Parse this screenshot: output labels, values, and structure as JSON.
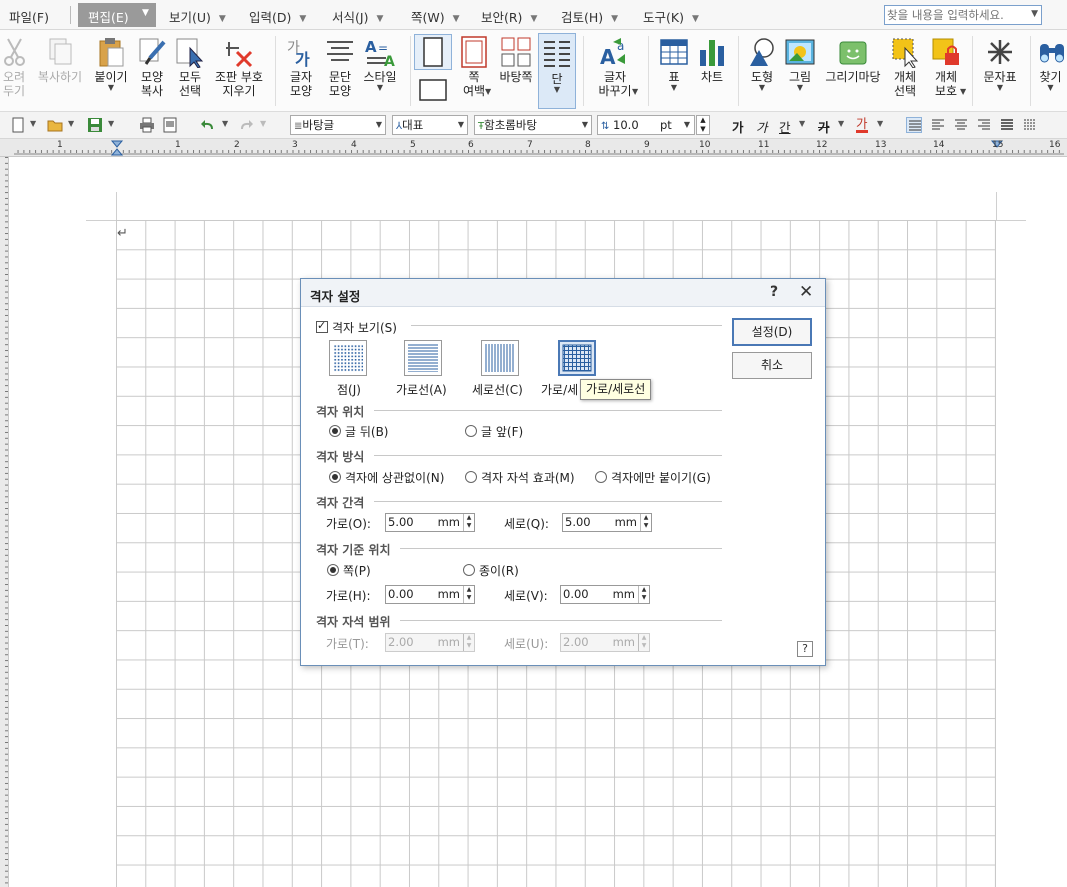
{
  "menubar": {
    "items": [
      {
        "label": "파일(F)"
      },
      {
        "label": "편집(E)"
      },
      {
        "label": "보기(U)"
      },
      {
        "label": "입력(D)"
      },
      {
        "label": "서식(J)"
      },
      {
        "label": "쪽(W)"
      },
      {
        "label": "보안(R)"
      },
      {
        "label": "검토(H)"
      },
      {
        "label": "도구(K)"
      }
    ],
    "active": "편집(E)",
    "search_placeholder": "찾을 내용을 입력하세요."
  },
  "ribbon": {
    "cut": "오려\n두기",
    "copy": "복사하기",
    "paste": "붙이기",
    "format_copy": "모양\n복사",
    "select_all": "모두\n선택",
    "clear_marks": "조판 부호\n지우기",
    "char_shape": "글자\n모양",
    "para_shape": "문단\n모양",
    "style": "스타일",
    "page_margin": "쪽\n여백",
    "background": "바탕쪽",
    "column": "단",
    "replace_char": "글자\n바꾸기",
    "table": "표",
    "chart": "차트",
    "shape": "도형",
    "picture": "그림",
    "drawing": "그리기마당",
    "obj_select": "개체\n선택",
    "obj_protect": "개체\n보호",
    "char_map": "문자표",
    "find": "찾기"
  },
  "fmtbar": {
    "style_combo": "바탕글",
    "lang_combo": "대표",
    "font_combo": "함초롬바탕",
    "size_value": "10.0",
    "size_unit": "pt",
    "bold": "가",
    "italic": "가",
    "underline": "간",
    "strike": "가",
    "color": "가"
  },
  "ruler": {
    "numbers": [
      "1",
      "1",
      "2",
      "3",
      "4",
      "5",
      "6",
      "7",
      "8",
      "9",
      "10",
      "11",
      "12",
      "13",
      "14",
      "15",
      "16"
    ]
  },
  "document": {
    "para_mark": "↵"
  },
  "dialog": {
    "title": "격자 설정",
    "help": "?",
    "close": "✕",
    "show_grid_label": "격자 보기(S)",
    "grid_types": [
      {
        "label": "점(J)"
      },
      {
        "label": "가로선(A)"
      },
      {
        "label": "세로선(C)"
      },
      {
        "label": "가로/세로선"
      }
    ],
    "grid_types_visible_last_label": "가로/세",
    "tooltip": "가로/세로선",
    "sec_position": "격자 위치",
    "pos_behind": "글 뒤(B)",
    "pos_front": "글 앞(F)",
    "sec_method": "격자 방식",
    "method_ignore": "격자에 상관없이(N)",
    "method_magnet": "격자 자석 효과(M)",
    "method_snap": "격자에만 붙이기(G)",
    "sec_spacing": "격자 간격",
    "spacing_h_label": "가로(O):",
    "spacing_h_value": "5.00",
    "spacing_v_label": "세로(Q):",
    "spacing_v_value": "5.00",
    "sec_origin": "격자 기준 위치",
    "origin_page": "쪽(P)",
    "origin_paper": "종이(R)",
    "origin_h_label": "가로(H):",
    "origin_h_value": "0.00",
    "origin_v_label": "세로(V):",
    "origin_v_value": "0.00",
    "sec_magnet": "격자 자석 범위",
    "magnet_h_label": "가로(T):",
    "magnet_h_value": "2.00",
    "magnet_v_label": "세로(U):",
    "magnet_v_value": "2.00",
    "unit": "mm",
    "btn_ok": "설정(D)",
    "btn_cancel": "취소",
    "help_small": "?"
  }
}
